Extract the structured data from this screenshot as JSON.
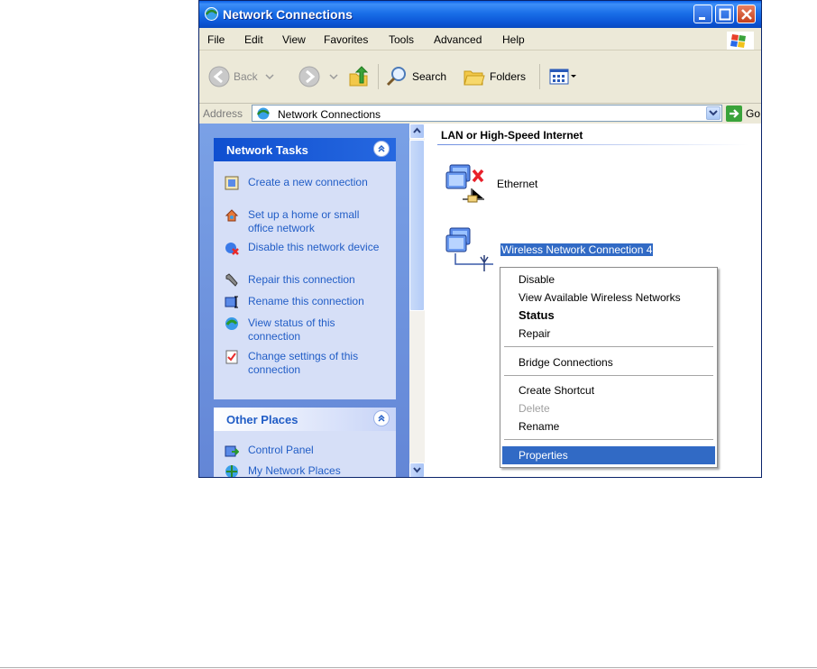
{
  "window": {
    "title": "Network Connections"
  },
  "menu": {
    "items": [
      "File",
      "Edit",
      "View",
      "Favorites",
      "Tools",
      "Advanced",
      "Help"
    ]
  },
  "toolbar": {
    "back_label": "Back",
    "search_label": "Search",
    "folders_label": "Folders"
  },
  "address": {
    "label": "Address",
    "value": "Network Connections",
    "go_label": "Go"
  },
  "task_pane": {
    "network_tasks": {
      "title": "Network Tasks",
      "items": [
        {
          "label": "Create a new connection",
          "icon": "new-connection-icon"
        },
        {
          "label": "Set up a home or small office network",
          "icon": "home-network-icon"
        },
        {
          "label": "Disable this network device",
          "icon": "disable-device-icon"
        },
        {
          "label": "Repair this connection",
          "icon": "repair-icon"
        },
        {
          "label": "Rename this connection",
          "icon": "rename-icon"
        },
        {
          "label": "View status of this connection",
          "icon": "status-icon"
        },
        {
          "label": "Change settings of this connection",
          "icon": "settings-icon"
        }
      ]
    },
    "other_places": {
      "title": "Other Places",
      "items": [
        {
          "label": "Control Panel",
          "icon": "control-panel-icon"
        },
        {
          "label": "My Network Places",
          "icon": "network-places-icon"
        }
      ]
    }
  },
  "content": {
    "group_title": "LAN or High-Speed Internet",
    "connections": [
      {
        "label": "Ethernet",
        "status": "disabled",
        "icon": "lan-connection-icon"
      },
      {
        "label": "Wireless Network Connection 4",
        "selected": true,
        "icon": "wireless-connection-icon"
      }
    ]
  },
  "context_menu": {
    "items": [
      {
        "label": "Disable"
      },
      {
        "label": "View Available Wireless Networks"
      },
      {
        "label": "Status",
        "bold": true
      },
      {
        "label": "Repair"
      },
      {
        "label": "Bridge Connections"
      },
      {
        "label": "Create Shortcut"
      },
      {
        "label": "Delete",
        "disabled": true
      },
      {
        "label": "Rename"
      },
      {
        "label": "Properties",
        "highlighted": true
      }
    ]
  },
  "colors": {
    "titlebar": "#0b55d6",
    "selection": "#316ac5",
    "task_link": "#215dc6"
  }
}
